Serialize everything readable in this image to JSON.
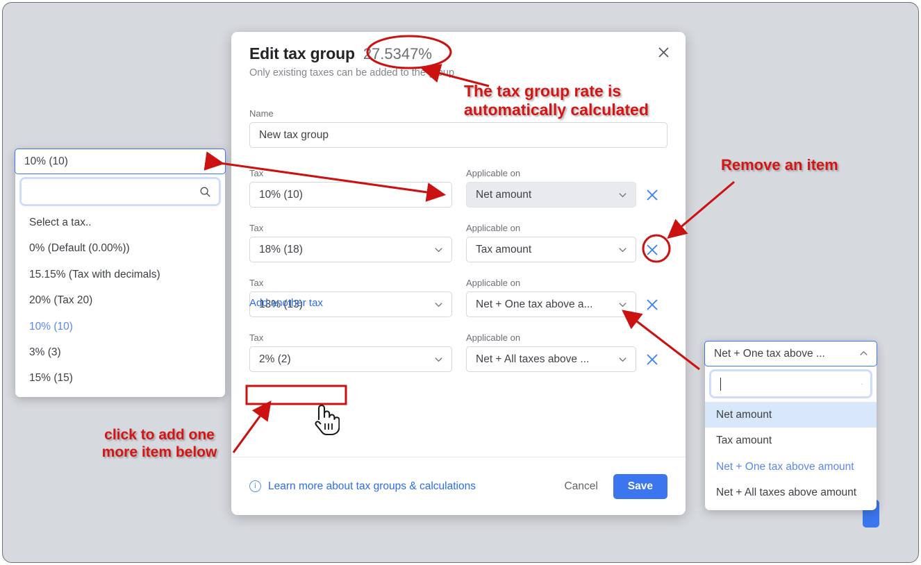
{
  "dialog": {
    "title": "Edit tax group",
    "rate": "27.5347%",
    "subtitle": "Only existing taxes can be added to the group",
    "close_icon": "close-icon",
    "name_label": "Name",
    "name_value": "New tax group",
    "add_another_label": "Add another tax",
    "footer": {
      "info_icon": "info-circle-icon",
      "learn_more": "Learn more about tax groups & calculations",
      "cancel_label": "Cancel",
      "save_label": "Save"
    },
    "labels": {
      "tax": "Tax",
      "applicable_on": "Applicable on"
    },
    "rows": [
      {
        "tax": "10% (10)",
        "applicable_on": "Net amount",
        "applicable_disabled": true
      },
      {
        "tax": "18% (18)",
        "applicable_on": "Tax amount",
        "applicable_disabled": false
      },
      {
        "tax": "13% (13)",
        "applicable_on": "Net + One tax above a...",
        "applicable_disabled": false
      },
      {
        "tax": "2% (2)",
        "applicable_on": "Net + All taxes above ...",
        "applicable_disabled": false
      }
    ]
  },
  "tax_popover": {
    "selected": "10% (10)",
    "search_value": "",
    "search_icon": "search-icon",
    "chevron_icon": "chevron-up-icon",
    "options": [
      "Select a tax..",
      "0% (Default (0.00%))",
      "15.15% (Tax with decimals)",
      "20% (Tax 20)",
      "10% (10)",
      "3% (3)",
      "15% (15)"
    ],
    "selected_index": 4
  },
  "applicable_popover": {
    "selected": "Net + One tax above ...",
    "search_value": "",
    "search_icon": "search-icon",
    "chevron_icon": "chevron-up-icon",
    "options": [
      "Net amount",
      "Tax amount",
      "Net + One tax above amount",
      "Net + All taxes above amount"
    ],
    "selected_index": 2,
    "hover_index": 0
  },
  "annotations": {
    "rate_note_line1": "The tax group rate is",
    "rate_note_line2": "automatically calculated",
    "remove_note": "Remove an item",
    "add_note_line1": "click to add one",
    "add_note_line2": "more item below"
  },
  "colors": {
    "accent_blue": "#3b76ef",
    "link_blue": "#2a6df0",
    "annotation_red": "#d61414",
    "page_background": "#d6d9de"
  }
}
